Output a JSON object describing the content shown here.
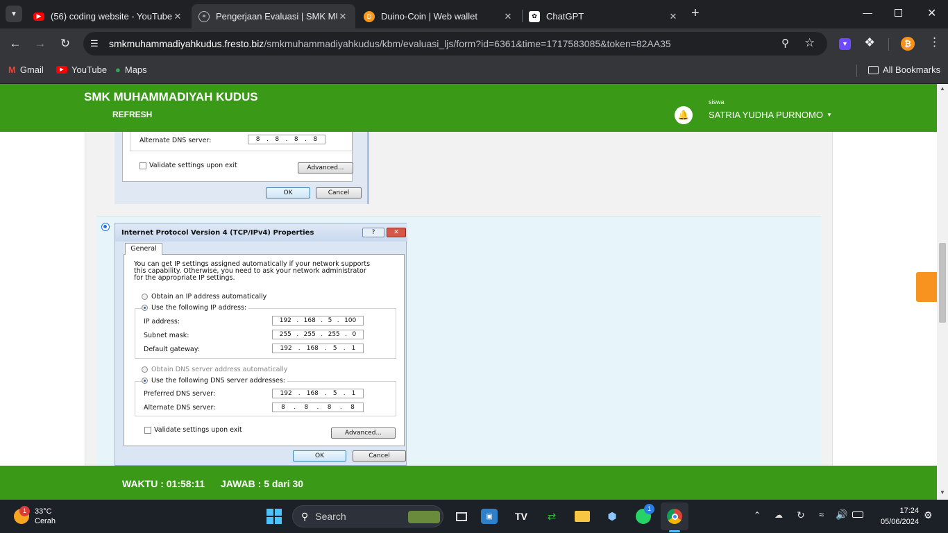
{
  "browser": {
    "tabs": [
      {
        "title": "(56) coding website - YouTube",
        "active": false
      },
      {
        "title": "Pengerjaan Evaluasi | SMK MUH",
        "active": true
      },
      {
        "title": "Duino-Coin | Web wallet",
        "active": false
      },
      {
        "title": "ChatGPT",
        "active": false
      }
    ],
    "url_host": "smkmuhammadiyahkudus.fresto.biz",
    "url_path": "/smkmuhammadiyahkudus/kbm/evaluasi_ljs/form?id=6361&time=1717583085&token=82AA35",
    "bookmarks": [
      "Gmail",
      "YouTube",
      "Maps"
    ],
    "all_bookmarks": "All Bookmarks"
  },
  "header": {
    "school": "SMK MUHAMMADIYAH KUDUS",
    "refresh": "REFRESH",
    "role": "siswa",
    "user": "SATRIA YUDHA PURNOMO",
    "brand_color": "#3a9a18"
  },
  "dialog_top": {
    "alt_dns_label": "Alternate DNS server:",
    "alt_dns": [
      "8",
      "8",
      "8",
      "8"
    ],
    "validate": "Validate settings upon exit",
    "advanced": "Advanced...",
    "ok": "OK",
    "cancel": "Cancel"
  },
  "dialog_main": {
    "title": "Internet Protocol Version 4 (TCP/IPv4) Properties",
    "tab": "General",
    "intro1": "You can get IP settings assigned automatically if your network supports",
    "intro2": "this capability. Otherwise, you need to ask your network administrator",
    "intro3": "for the appropriate IP settings.",
    "obtain_ip": "Obtain an IP address automatically",
    "use_ip": "Use the following IP address:",
    "ip_label": "IP address:",
    "ip": [
      "192",
      "168",
      "5",
      "100"
    ],
    "mask_label": "Subnet mask:",
    "mask": [
      "255",
      "255",
      "255",
      "0"
    ],
    "gw_label": "Default gateway:",
    "gw": [
      "192",
      "168",
      "5",
      "1"
    ],
    "obtain_dns": "Obtain DNS server address automatically",
    "use_dns": "Use the following DNS server addresses:",
    "pref_dns_label": "Preferred DNS server:",
    "pref_dns": [
      "192",
      "168",
      "5",
      "1"
    ],
    "alt_dns_label": "Alternate DNS server:",
    "alt_dns": [
      "8",
      "8",
      "8",
      "8"
    ],
    "validate": "Validate settings upon exit",
    "advanced": "Advanced...",
    "ok": "OK",
    "cancel": "Cancel"
  },
  "footer": {
    "waktu": "WAKTU : 01:58:11",
    "jawab": "JAWAB : 5 dari 30"
  },
  "taskbar": {
    "temp": "33°C",
    "weather": "Cerah",
    "weather_badge": "1",
    "search": "Search",
    "whatsapp_badge": "1",
    "time": "17:24",
    "date": "05/06/2024"
  }
}
